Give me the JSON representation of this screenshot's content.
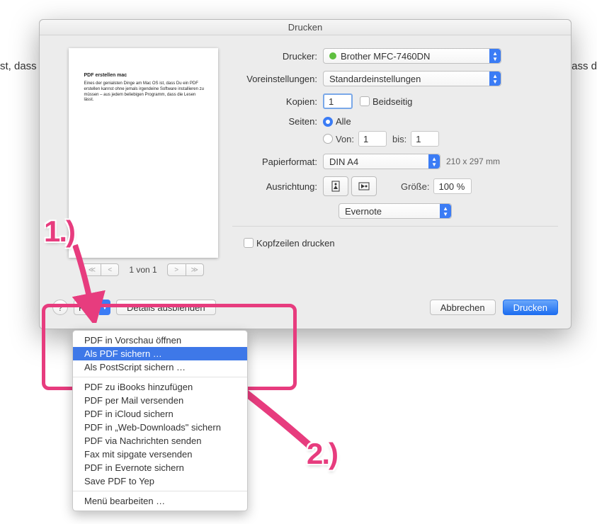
{
  "bg_text_left": "st, dass",
  "bg_text_right": "lass d",
  "dialog": {
    "title": "Drucken",
    "preview_title": "PDF erstellen mac",
    "preview_body": "Eines der genialsten Dinge am Mac OS ist, dass Du ein PDF erstellen kannst ohne jemals irgendeine Software installieren zu müssen – aus jedem beliebigen Programm, dass die Lesen lässt.",
    "pager_label": "1 von 1",
    "labels": {
      "printer": "Drucker:",
      "prefs": "Voreinstellungen:",
      "copies": "Kopien:",
      "both_sides": "Beidseitig",
      "pages": "Seiten:",
      "pages_all": "Alle",
      "pages_from": "Von:",
      "pages_to": "bis:",
      "papersize": "Papierformat:",
      "orientation": "Ausrichtung:",
      "size": "Größe:",
      "print_headers": "Kopfzeilen drucken"
    },
    "printer_value": "Brother MFC-7460DN",
    "prefs_value": "Standardeinstellungen",
    "copies_value": "1",
    "pages_from_value": "1",
    "pages_to_value": "1",
    "papersize_value": "DIN A4",
    "papersize_dim": "210 x 297 mm",
    "size_value": "100 %",
    "app_value": "Evernote",
    "pdf_button": "PDF",
    "details_button": "Details ausblenden",
    "cancel": "Abbrechen",
    "print": "Drucken"
  },
  "menu": {
    "items_a": [
      "PDF in Vorschau öffnen",
      "Als PDF sichern …",
      "Als PostScript sichern …"
    ],
    "highlighted_index": 1,
    "items_b": [
      "PDF zu iBooks hinzufügen",
      "PDF per Mail versenden",
      "PDF in iCloud sichern",
      "PDF in „Web-Downloads\" sichern",
      "PDF via Nachrichten senden",
      "Fax mit sipgate versenden",
      "PDF in Evernote sichern",
      "Save PDF to Yep"
    ],
    "items_c": [
      "Menü bearbeiten …"
    ]
  },
  "annotations": {
    "one": "1.)",
    "two": "2.)"
  }
}
